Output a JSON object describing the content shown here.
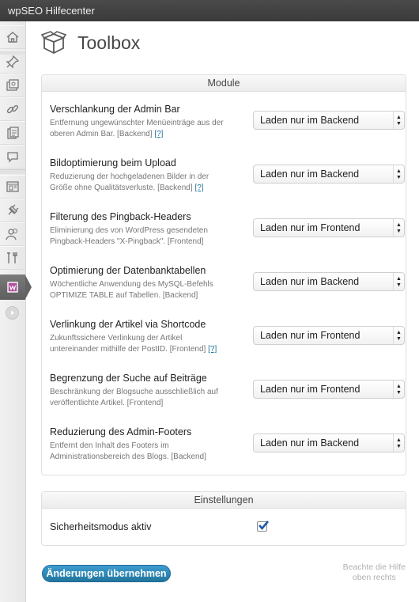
{
  "window": {
    "title": "wpSEO Hilfecenter"
  },
  "sidebar": {
    "items": [
      {
        "icon": "home-icon"
      },
      {
        "icon": "pin-icon"
      },
      {
        "icon": "media-icon"
      },
      {
        "icon": "link-icon"
      },
      {
        "icon": "pages-icon"
      },
      {
        "icon": "comments-icon"
      },
      {
        "icon": "appearance-icon"
      },
      {
        "icon": "plugins-icon"
      },
      {
        "icon": "users-icon"
      },
      {
        "icon": "tools-icon"
      },
      {
        "icon": "wpseo-icon",
        "active": true
      },
      {
        "icon": "collapse-menu-icon"
      }
    ]
  },
  "page": {
    "title": "Toolbox",
    "icon": "toolbox-icon"
  },
  "modules": {
    "heading": "Module",
    "items": [
      {
        "title": "Verschlankung der Admin Bar",
        "desc": "Entfernung ungewünschter Menüeinträge aus der oberen Admin Bar. [Backend]",
        "help": "[?]",
        "select": "Laden nur im Backend"
      },
      {
        "title": "Bildoptimierung beim Upload",
        "desc": "Reduzierung der hochgeladenen Bilder in der Größe ohne Qualitätsverluste. [Backend]",
        "help": "[?]",
        "select": "Laden nur im Backend"
      },
      {
        "title": "Filterung des Pingback-Headers",
        "desc": "Eliminierung des von WordPress gesendeten Pingback-Headers \"X-Pingback\". [Frontend]",
        "help": "",
        "select": "Laden nur im Frontend"
      },
      {
        "title": "Optimierung der Datenbanktabellen",
        "desc": "Wöchentliche Anwendung des MySQL-Befehls OPTIMIZE TABLE auf Tabellen. [Backend]",
        "help": "",
        "select": "Laden nur im Backend"
      },
      {
        "title": "Verlinkung der Artikel via Shortcode",
        "desc": "Zukunftssichere Verlinkung der Artikel untereinander mithilfe der PostID. [Frontend]",
        "help": "[?]",
        "select": "Laden nur im Frontend"
      },
      {
        "title": "Begrenzung der Suche auf Beiträge",
        "desc": "Beschränkung der Blogsuche ausschließlich auf veröffentlichte Artikel. [Frontend]",
        "help": "",
        "select": "Laden nur im Frontend"
      },
      {
        "title": "Reduzierung des Admin-Footers",
        "desc": "Entfernt den Inhalt des Footers im Administrationsbereich des Blogs. [Backend]",
        "help": "",
        "select": "Laden nur im Backend"
      }
    ]
  },
  "settings": {
    "heading": "Einstellungen",
    "safe_mode_label": "Sicherheitsmodus aktiv",
    "safe_mode_checked": true
  },
  "footer": {
    "submit_label": "Änderungen übernehmen",
    "note_line1": "Beachte die Hilfe",
    "note_line2": "oben rechts"
  }
}
